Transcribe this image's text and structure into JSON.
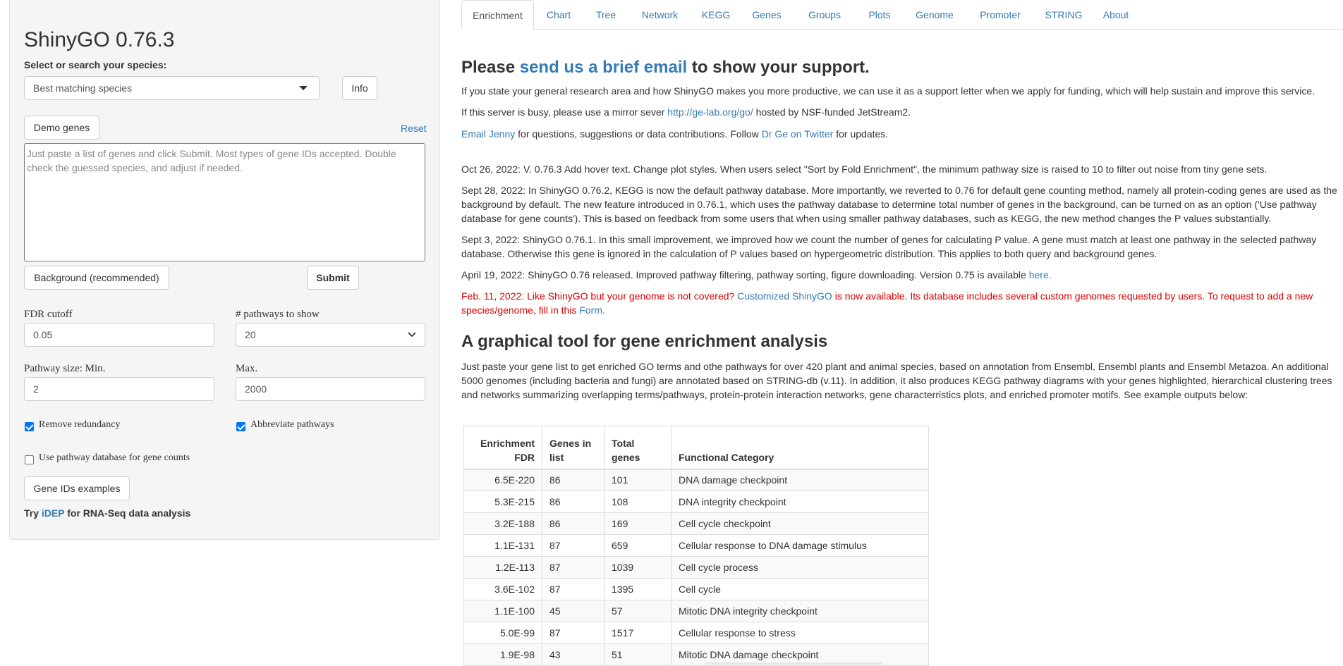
{
  "sidebar": {
    "title": "ShinyGO 0.76.3",
    "species_label": "Select or search your species:",
    "species_value": "Best matching species",
    "info_button": "Info",
    "demo_button": "Demo genes",
    "reset_link": "Reset",
    "gene_placeholder": "Just paste a list of genes and click Submit. Most types of gene IDs accepted. Double check the guessed species, and adjust if needed.",
    "background_button": "Background (recommended)",
    "submit_button": "Submit",
    "fdr_label": "FDR cutoff",
    "fdr_value": "0.05",
    "pathways_label": "# pathways to show",
    "pathways_value": "20",
    "pathway_min_label": "Pathway size: Min.",
    "pathway_min_value": "2",
    "pathway_max_label": "Max.",
    "pathway_max_value": "2000",
    "remove_redundancy_label": "Remove redundancy",
    "remove_redundancy_checked": true,
    "abbreviate_label": "Abbreviate pathways",
    "abbreviate_checked": true,
    "use_db_label": "Use pathway database for gene counts",
    "use_db_checked": false,
    "gene_ids_button": "Gene IDs examples",
    "try_prefix": "Try ",
    "idep_link": "iDEP",
    "try_suffix": " for RNA-Seq data analysis"
  },
  "tabs": [
    "Enrichment",
    "Chart",
    "Tree",
    "Network",
    "KEGG",
    "Genes",
    "Groups",
    "Plots",
    "Genome",
    "Promoter",
    "STRING",
    "About"
  ],
  "main": {
    "support_pre": "Please ",
    "support_link": "send us a brief email",
    "support_post": " to show your support.",
    "p1": "If you state your general research area and how ShinyGO makes you more productive, we can use it as a support letter when we apply for funding, which will help sustain and improve this service.",
    "p2_pre": "If this server is busy, please use a mirror sever ",
    "p2_link": "http://ge-lab.org/go/",
    "p2_post": " hosted by NSF-funded JetStream2.",
    "p3_link1": "Email Jenny",
    "p3_mid": " for questions, suggestions or data contributions. Follow ",
    "p3_link2": "Dr Ge on Twitter",
    "p3_post": " for updates.",
    "news1": "Oct 26, 2022: V. 0.76.3 Add hover text. Change plot styles. When users select \"Sort by Fold Enrichment\", the minimum pathway size is raised to 10 to filter out noise from tiny gene sets.",
    "news2": "Sept 28, 2022: In ShinyGO 0.76.2, KEGG is now the default pathway database. More importantly, we reverted to 0.76 for default gene counting method, namely all protein-coding genes are used as the background by default. The new feature introduced in 0.76.1, which uses the pathway database to determine total number of genes in the background, can be turned on as an option ('Use pathway database for gene counts'). This is based on feedback from some users that when using smaller pathway databases, such as KEGG, the new method changes the P values substantially.",
    "news3": "Sept 3, 2022: ShinyGO 0.76.1. In this small improvement, we improved how we count the number of genes for calculating P value. A gene must match at least one pathway in the selected pathway database. Otherwise this gene is ignored in the calculation of P values based on hypergeometric distribution. This applies to both query and background genes.",
    "news4_pre": "April 19, 2022: ShinyGO 0.76 released. Improved pathway filtering, pathway sorting, figure downloading. Version 0.75 is available ",
    "news4_link": "here.",
    "news5_pre": "Feb. 11, 2022: Like ShinyGO but your genome is not covered? ",
    "news5_link": "Customized ShinyGO",
    "news5_mid": " is now available. Its database includes several custom genomes requested by users. To request to add a new species/genome, fill in this ",
    "news5_link2": "Form.",
    "tool_heading": "A graphical tool for gene enrichment analysis",
    "tool_desc": "Just paste your gene list to get enriched GO terms and othe pathways for over 420 plant and animal species, based on annotation from Ensembl, Ensembl plants and Ensembl Metazoa. An additional 5000 genomes (including bacteria and fungi) are annotated based on STRING-db (v.11). In addition, it also produces KEGG pathway diagrams with your genes highlighted, hierarchical clustering trees and networks summarizing overlapping terms/pathways, protein-protein interaction networks, gene characterristics plots, and enriched promoter motifs. See example outputs below:"
  },
  "table": {
    "headers": [
      "Enrichment FDR",
      "Genes in list",
      "Total genes",
      "Functional Category"
    ],
    "rows": [
      [
        "6.5E-220",
        "86",
        "101",
        "DNA damage checkpoint"
      ],
      [
        "5.3E-215",
        "86",
        "108",
        "DNA integrity checkpoint"
      ],
      [
        "3.2E-188",
        "86",
        "169",
        "Cell cycle checkpoint"
      ],
      [
        "1.1E-131",
        "87",
        "659",
        "Cellular response to DNA damage stimulus"
      ],
      [
        "1.2E-113",
        "87",
        "1039",
        "Cell cycle process"
      ],
      [
        "3.6E-102",
        "87",
        "1395",
        "Cell cycle"
      ],
      [
        "1.1E-100",
        "45",
        "57",
        "Mitotic DNA integrity checkpoint"
      ],
      [
        "5.0E-99",
        "87",
        "1517",
        "Cellular response to stress"
      ],
      [
        "1.9E-98",
        "43",
        "51",
        "Mitotic DNA damage checkpoint"
      ]
    ]
  },
  "colors": {
    "link": "#337ab7",
    "alert_red": "#dd0000",
    "checkbox_blue": "#0075ff",
    "sidebar_bg": "#f5f5f5"
  },
  "icons": {
    "dropdown": "chevron-down-icon",
    "checkbox": "checkmark-icon"
  }
}
